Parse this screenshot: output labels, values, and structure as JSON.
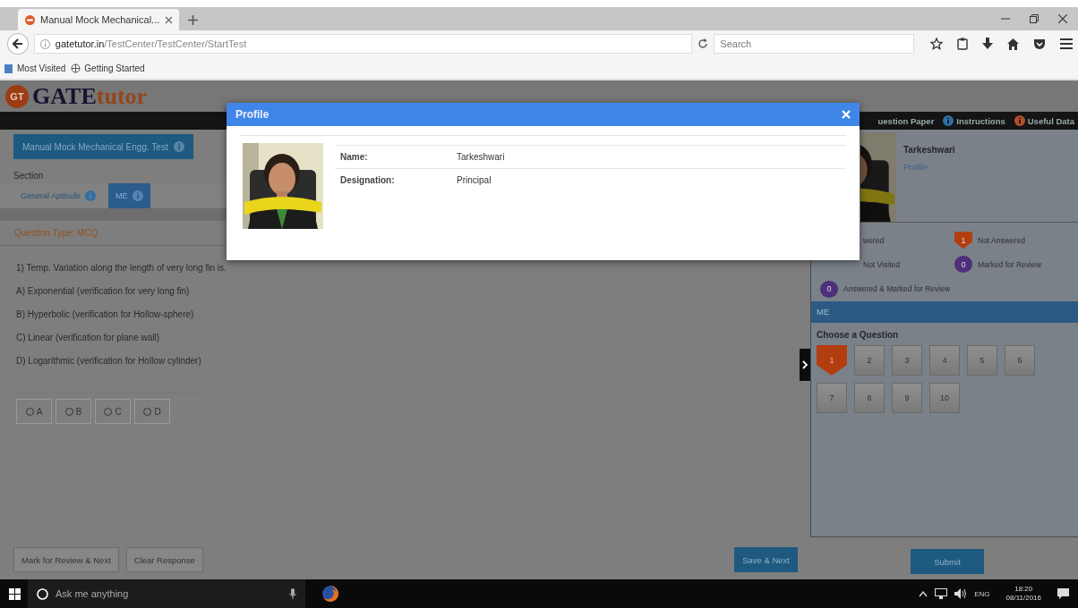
{
  "browser": {
    "tab_title": "Manual Mock Mechanical...",
    "url_host": "gatetutor.in",
    "url_path": "/TestCenter/TestCenter/StartTest",
    "search_placeholder": "Search",
    "bookmarks": [
      "Most Visited",
      "Getting Started"
    ]
  },
  "header": {
    "logo_badge": "GT",
    "logo_bold": "GATE",
    "logo_light": "tutor",
    "links": [
      {
        "label": "uestion Paper"
      },
      {
        "label": "Instructions",
        "color": "#2f6fa8"
      },
      {
        "label": "Useful Data",
        "color": "#b0502a"
      }
    ]
  },
  "test": {
    "title": "Manual Mock Mechanical Engg. Test",
    "section_label": "Section",
    "sections": [
      {
        "label": "General Aptitude",
        "selected": false
      },
      {
        "label": "ME",
        "selected": true
      }
    ],
    "question_type": "Question Type: MCQ",
    "question": "1) Temp. Variation along the length of very long fin is.",
    "choices": [
      "A) Exponential (verification for very long fin)",
      "B) Hyperbolic (verification for Hollow-sphere)",
      "C) Linear (verification for plane wall)",
      "D) Logarithmic (verification for Hollow cylinder)"
    ],
    "answer_options": [
      {
        "label": "A",
        "selected": false
      },
      {
        "label": "B",
        "selected": false
      },
      {
        "label": "C",
        "selected": false
      },
      {
        "label": "D",
        "selected": false
      }
    ],
    "buttons": [
      "Mark for Review & Next",
      "Clear Response",
      "Save & Next"
    ]
  },
  "panel": {
    "candidate": "Tarkeshwari",
    "profile_link": "Profile",
    "legend": [
      {
        "label": "wered"
      },
      {
        "kind": "not_answered",
        "label": "Not Answered",
        "count": "1"
      },
      {
        "label": "Not Visited"
      },
      {
        "kind": "marked",
        "label": "Marked for Review",
        "count": "0"
      },
      {
        "kind": "answered_marked",
        "label": "Answered & Marked for Review",
        "count": "0"
      }
    ],
    "section_bar": "ME",
    "choose_label": "Choose a Question",
    "questions": [
      {
        "number": "1",
        "kind": "not_answered"
      },
      {
        "number": "2",
        "kind": "not_visited"
      },
      {
        "number": "3",
        "kind": "not_visited"
      },
      {
        "number": "4",
        "kind": "not_visited"
      },
      {
        "number": "5",
        "kind": "not_visited"
      },
      {
        "number": "6",
        "kind": "not_visited"
      },
      {
        "number": "7",
        "kind": "not_visited"
      },
      {
        "number": "8",
        "kind": "not_visited"
      },
      {
        "number": "9",
        "kind": "not_visited"
      },
      {
        "number": "10",
        "kind": "not_visited"
      }
    ],
    "submit": "Submit"
  },
  "modal": {
    "title": "Profile",
    "fields": [
      {
        "label": "Name:",
        "value": "Tarkeshwari"
      },
      {
        "label": "Designation:",
        "value": "Principal"
      }
    ]
  },
  "taskbar": {
    "search_placeholder": "Ask me anything",
    "language": "ENG",
    "time": "18:20",
    "date": "08/11/2016"
  }
}
